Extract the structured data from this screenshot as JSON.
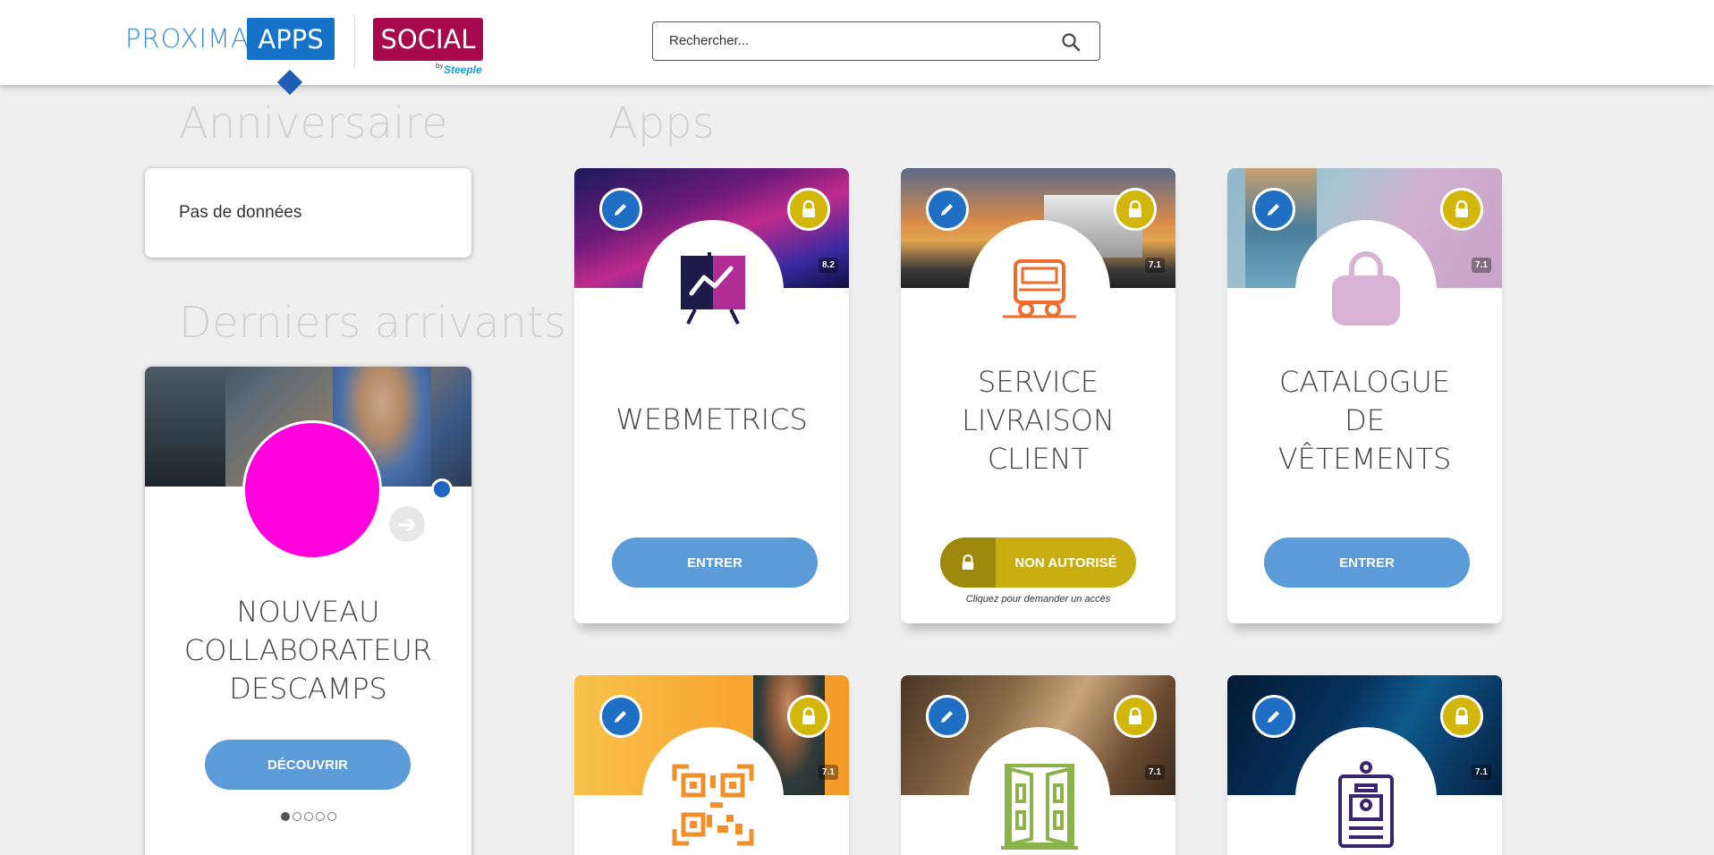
{
  "header": {
    "logo_proxima": "PROXIMA",
    "logo_apps": "APPS",
    "logo_social": "SOCIAL",
    "logo_by": "by",
    "logo_steeple": "Steeple",
    "search_placeholder": "Rechercher..."
  },
  "sections": {
    "birthday_title": "Anniversaire",
    "birthday_empty": "Pas de données",
    "newcomers_title": "Derniers arrivants",
    "apps_title": "Apps"
  },
  "newcomer": {
    "name_line1": "NOUVEAU",
    "name_line2": "COLLABORATEUR",
    "name_line3": "DESCAMPS",
    "discover_label": "DÉCOUVRIR",
    "carousel_total": 5,
    "carousel_active": 1,
    "avatar_color": "#ff00dd",
    "status_color": "#1e64c0"
  },
  "apps": [
    {
      "title_lines": [
        "WEBMETRICS"
      ],
      "version": "8.2",
      "action": "ENTRER",
      "icon": "presentation-chart-icon"
    },
    {
      "title_lines": [
        "SERVICE",
        "LIVRAISON",
        "CLIENT"
      ],
      "version": "7.1",
      "action": "NON AUTORISÉ",
      "note": "Cliquez pour demander un accès",
      "icon": "truck-icon"
    },
    {
      "title_lines": [
        "CATALOGUE",
        "DE",
        "VÊTEMENTS"
      ],
      "version": "7.1",
      "action": "ENTRER",
      "icon": "shopping-bag-icon"
    },
    {
      "version": "7.1",
      "icon": "qr-code-icon"
    },
    {
      "version": "7.1",
      "icon": "door-icon"
    },
    {
      "version": "7.1",
      "icon": "id-badge-icon"
    }
  ],
  "colors": {
    "primary_button": "#5b9bd8",
    "edit_badge": "#1f6fc5",
    "lock_badge": "#d2b70a",
    "denied_button": "#c9ae12"
  }
}
